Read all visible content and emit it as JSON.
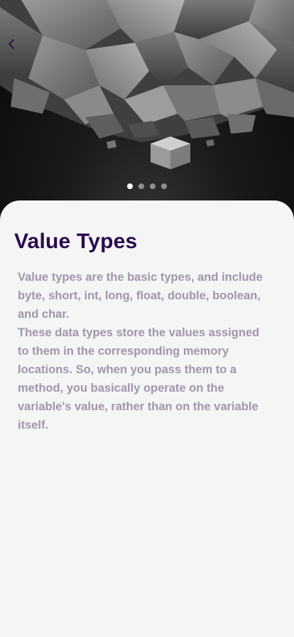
{
  "header": {
    "back_icon": "chevron-left-icon",
    "back_color": "#2a0b4e"
  },
  "carousel": {
    "page_count": 4,
    "active_index": 0
  },
  "content": {
    "title": "Value Types",
    "paragraph_1": "Value types are the basic types, and include byte, short, int, long, float, double, boolean, and char.",
    "paragraph_2": "These data types store the values assigned to them in the corresponding memory locations. So, when you pass them to a method, you basically operate on the variable's value, rather than on the variable itself."
  },
  "colors": {
    "title": "#2a0b4e",
    "body_text": "#a195ad",
    "background": "#f5f5f5",
    "dot_active": "#ffffff",
    "dot_inactive": "#8e8e8e"
  }
}
